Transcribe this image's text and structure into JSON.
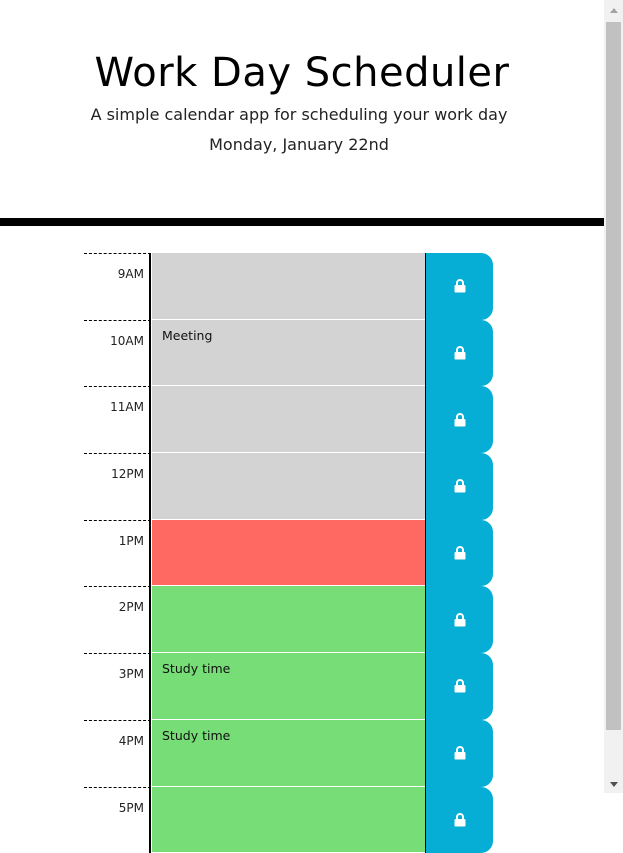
{
  "header": {
    "title": "Work Day Scheduler",
    "subtitle": "A simple calendar app for scheduling your work day",
    "date": "Monday, January 22nd"
  },
  "colors": {
    "past": "#d3d3d3",
    "present": "#ff6961",
    "future": "#77dd77",
    "save": "#06aed5"
  },
  "rows": [
    {
      "hour": "9AM",
      "text": "",
      "state": "past"
    },
    {
      "hour": "10AM",
      "text": "Meeting",
      "state": "past"
    },
    {
      "hour": "11AM",
      "text": "",
      "state": "past"
    },
    {
      "hour": "12PM",
      "text": "",
      "state": "past"
    },
    {
      "hour": "1PM",
      "text": "",
      "state": "present"
    },
    {
      "hour": "2PM",
      "text": "",
      "state": "future"
    },
    {
      "hour": "3PM",
      "text": "Study time",
      "state": "future"
    },
    {
      "hour": "4PM",
      "text": "Study time",
      "state": "future"
    },
    {
      "hour": "5PM",
      "text": "",
      "state": "future"
    }
  ],
  "icons": {
    "save": "lock-icon"
  }
}
